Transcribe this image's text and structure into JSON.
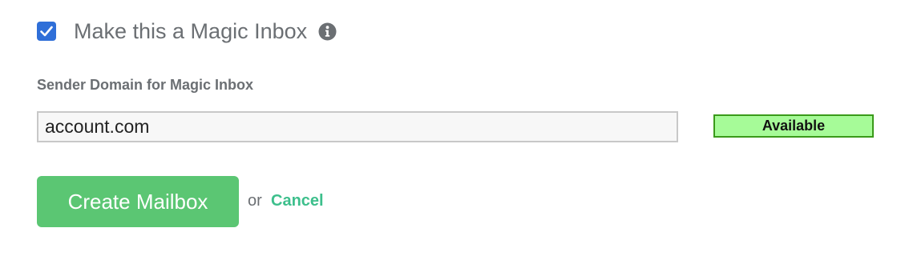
{
  "magic_inbox": {
    "checkbox_checked": true,
    "label": "Make this a Magic Inbox",
    "info_icon": "info-circle-icon"
  },
  "sender_domain": {
    "label": "Sender Domain for Magic Inbox",
    "value": "account.com",
    "status": "Available",
    "status_color": "#a6fb98"
  },
  "actions": {
    "create_label": "Create Mailbox",
    "or_text": "or",
    "cancel_label": "Cancel"
  },
  "colors": {
    "checkbox": "#2f6fd8",
    "primary_button": "#5bc673",
    "link": "#3dbf8c"
  }
}
